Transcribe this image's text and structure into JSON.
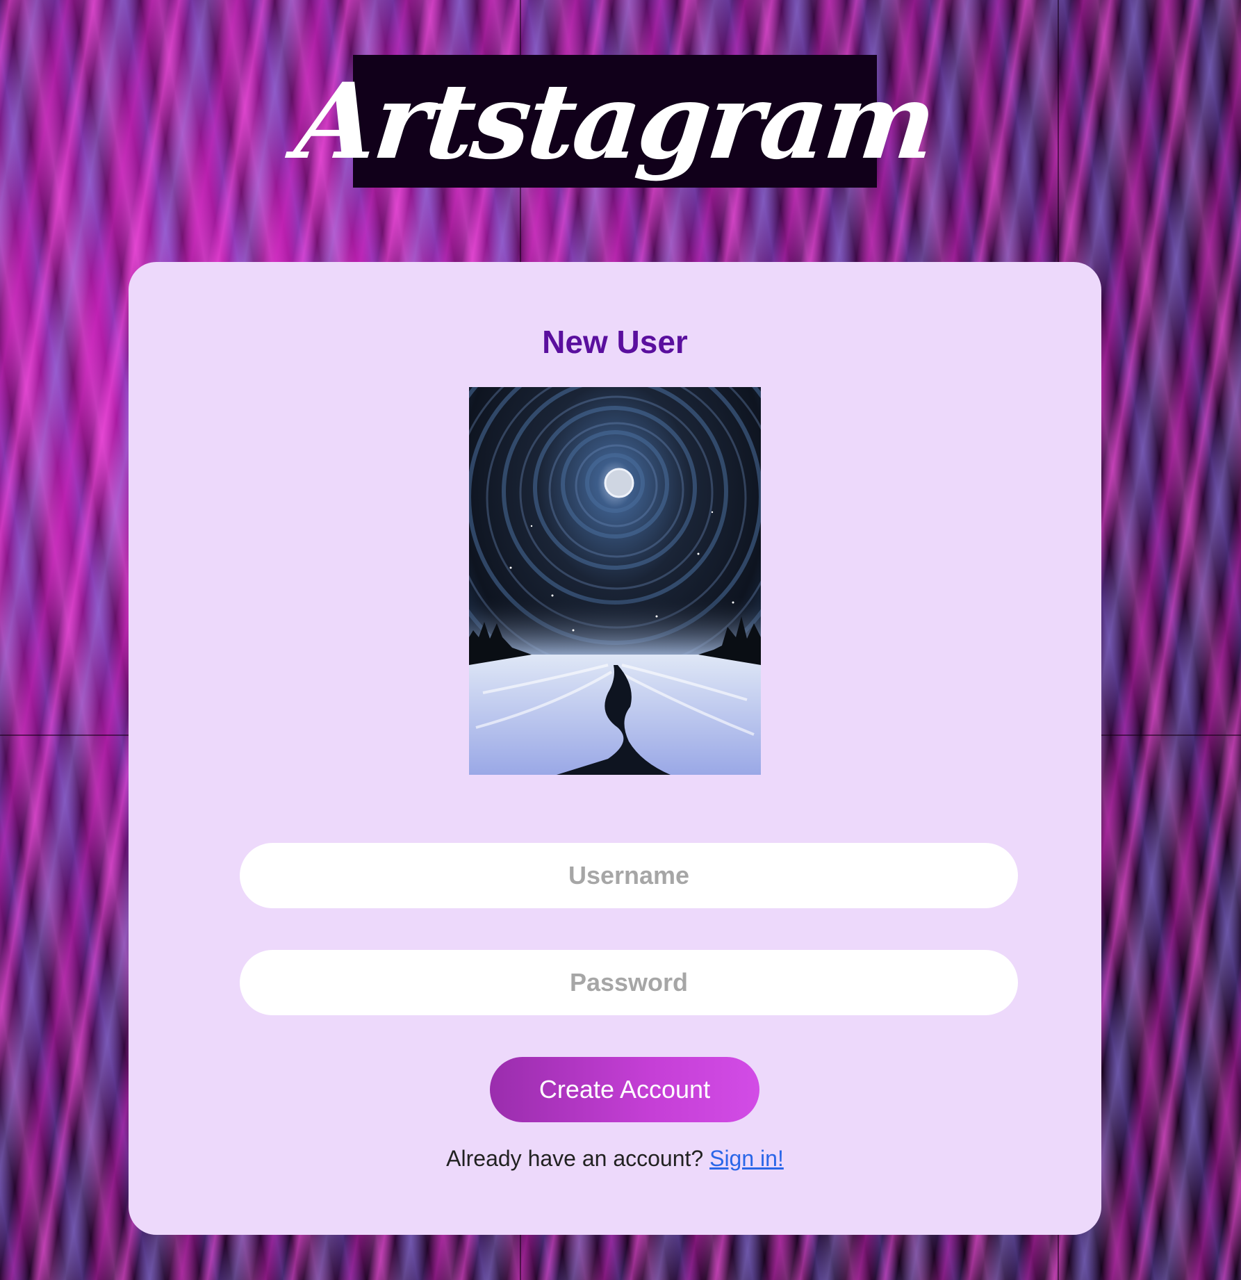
{
  "app": {
    "logo_text": "Artstagram"
  },
  "form": {
    "title": "New User",
    "artwork_image": "night-sky-snow-road-painting",
    "username_placeholder": "Username",
    "password_placeholder": "Password",
    "submit_label": "Create Account",
    "signin_prompt": "Already have an account?",
    "signin_link": "Sign in!"
  },
  "colors": {
    "card_background": "#edd9fb",
    "title": "#5a0f9e",
    "button_gradient_start": "#9a2dad",
    "button_gradient_end": "#d24ce6",
    "link": "#2a66e8",
    "logo_background": "#11001a"
  }
}
